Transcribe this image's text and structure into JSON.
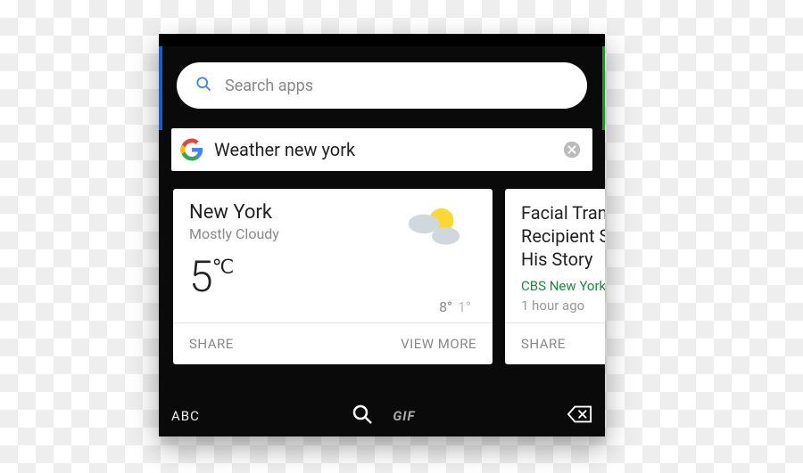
{
  "search": {
    "placeholder": "Search apps",
    "query": "Weather new york"
  },
  "cards": {
    "weather": {
      "city": "New York",
      "condition": "Mostly Cloudy",
      "temperature": "5",
      "unit": "℃",
      "high": "8°",
      "low": "1°",
      "share_label": "SHARE",
      "viewmore_label": "VIEW MORE"
    },
    "news": {
      "headline": "Facial Transplant Recipient Shares His Story",
      "source": "CBS New York",
      "age": "1 hour ago",
      "share_label": "SHARE"
    }
  },
  "keyboard": {
    "abc_label": "ABC",
    "gif_label": "GIF"
  },
  "icons": {
    "search": "search-icon",
    "google": "google-logo",
    "clear": "clear-icon",
    "weather": "mostly-cloudy-icon",
    "backspace": "backspace-icon"
  }
}
